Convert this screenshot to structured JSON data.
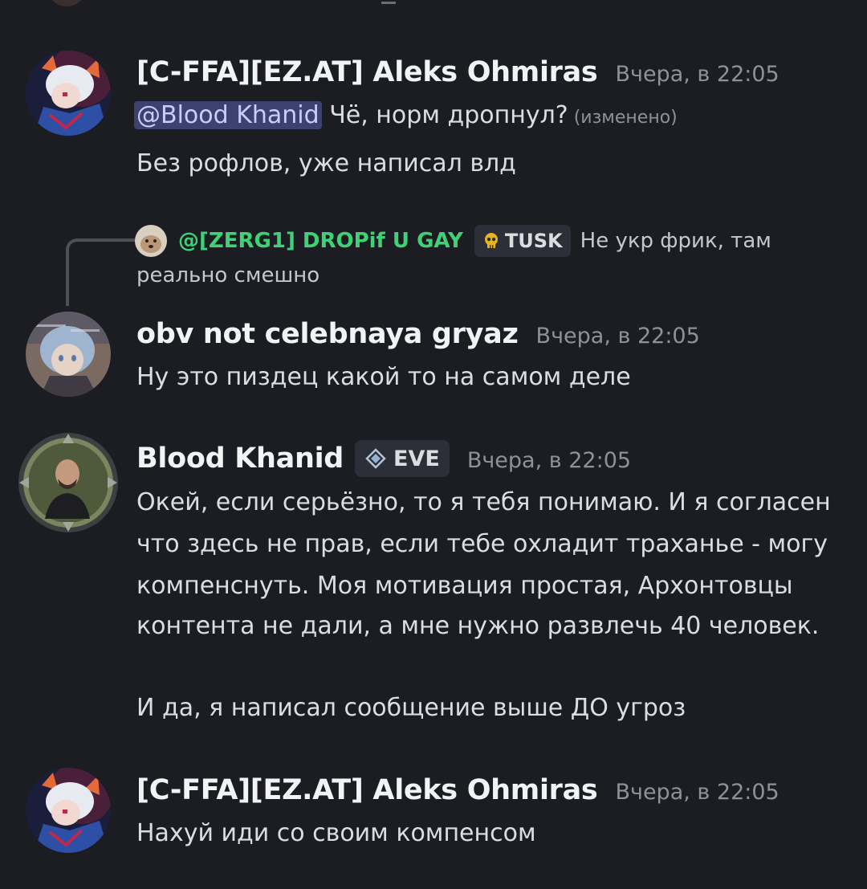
{
  "colors": {
    "background": "#1c1d23",
    "text": "#dbdee1",
    "username": "#f2f3f5",
    "timestamp": "#8e9297",
    "mention_bg": "#3c4270",
    "mention_text": "#c9cdfb",
    "reply_author": "#3fd176",
    "tag_bg": "#2c2f37"
  },
  "messages": [
    {
      "author": "[C-FFA][EZ.AT] Aleks Ohmiras",
      "timestamp": "Вчера, в 22:05",
      "avatar_icon": "anime-character-avatar",
      "mention": "@Blood Khanid",
      "lines": [
        " Чё, норм дропнул?",
        "Без рофлов, уже написал влд"
      ],
      "edited_label": " (изменено)"
    },
    {
      "reply": {
        "author": "@[ZERG1] DROPif U GAY",
        "avatar_icon": "dog-avatar",
        "tag_icon": "skull-icon",
        "tag_label": "TUSK",
        "text": "Не укр фрик, там",
        "text_continued": "реально смешно"
      },
      "author": "obv not celebnaya gryaz",
      "timestamp": "Вчера, в 22:05",
      "avatar_icon": "anime-girl-avatar",
      "lines": [
        "Ну это пиздец какой то на самом деле"
      ]
    },
    {
      "author": "Blood Khanid",
      "timestamp": "Вчера, в 22:05",
      "avatar_icon": "bald-man-framed-avatar",
      "tag_icon": "diamond-icon",
      "tag_label": "EVE",
      "lines": [
        "Окей, если серьёзно, то я тебя понимаю. И я согласен",
        "что здесь не прав, если тебе охладит траханье - могу",
        "компенснуть. Моя мотивация простая, Архонтовцы",
        "контента не дали, а мне нужно развлечь 40 человек.",
        "",
        "И да, я написал сообщение выше ДО угроз"
      ]
    },
    {
      "author": "[C-FFA][EZ.AT] Aleks Ohmiras",
      "timestamp": "Вчера, в 22:05",
      "avatar_icon": "anime-character-avatar",
      "lines": [
        "Нахуй иди со своим компенсом"
      ]
    }
  ]
}
